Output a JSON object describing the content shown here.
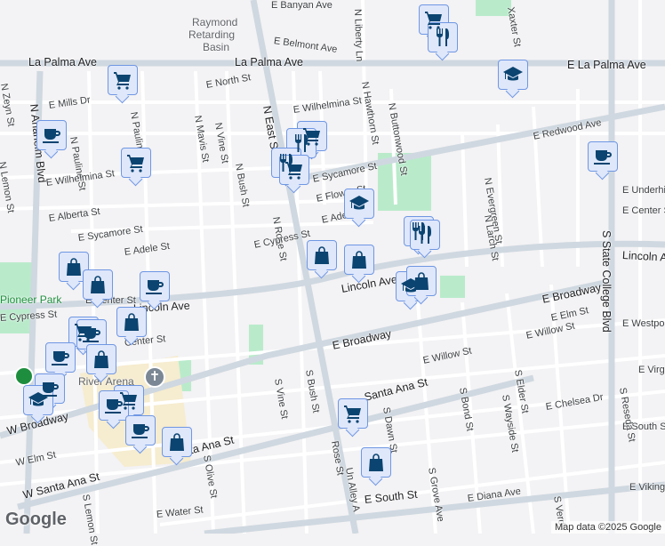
{
  "streets": [
    "E Banyan Ave",
    "Raymond",
    "Retarding",
    "Basin",
    "E Belmont Ave",
    "La Palma Ave",
    "La Palma Ave",
    "E La Palma Ave",
    "E North St",
    "N East St",
    "E Wilhelmina St",
    "E Mills Dr",
    "N Pauline St",
    "N Mavis St",
    "N Vine St",
    "N Bush St",
    "N Rose St",
    "E Sycamore St",
    "E Redwood Ave",
    "E Flower St",
    "E Adele St",
    "E Cypress St",
    "Lincoln Ave",
    "Lincoln Ave",
    "E Broadway",
    "E Broadway",
    "E Elm St",
    "E Willow St",
    "E Willow St",
    "S State College Blvd",
    "E Underhill",
    "E Center St",
    "E Westport",
    "E Virg",
    "E Chelsea Dr",
    "E South St",
    "E South St",
    "E Diana Ave",
    "E Viking A",
    "W Broadway",
    "W Elm St",
    "W Santa Ana St",
    "Santa Ana St",
    "Santa Ana St",
    "E Water St",
    "S Lemon St",
    "S Olive St",
    "S Vine St",
    "S Bush St",
    "S Dawn St",
    "S Grove Ave",
    "S Bond St",
    "S Wayside St",
    "S Elder St",
    "N Evergreen St",
    "N Larch St",
    "N Buttonwood St",
    "N Hawthorn St",
    "N Liberty Ln",
    "N Zeyn St",
    "N Lemon St",
    "N Anaheim Blvd",
    "N Pauline St",
    "E Wilhelmina St",
    "E Alberta St",
    "E Sycamore St",
    "E Adele St",
    "Lincoln Ave",
    "Center St",
    "S Reseda St",
    "S Verde",
    "Un Alley A",
    "Rose St",
    "Pioneer Park",
    "River Arena",
    "E Cypress St",
    "E Center St",
    "Xaxter St"
  ],
  "markers": [
    {
      "type": "shopping-cart"
    },
    {
      "type": "restaurant"
    },
    {
      "type": "shopping-cart"
    },
    {
      "type": "coffee"
    },
    {
      "type": "school"
    },
    {
      "type": "shopping-cart"
    },
    {
      "type": "coffee"
    },
    {
      "type": "shopping-cart"
    },
    {
      "type": "restaurant"
    },
    {
      "type": "restaurant"
    },
    {
      "type": "shopping-cart"
    },
    {
      "type": "school"
    },
    {
      "type": "restaurant"
    },
    {
      "type": "restaurant"
    },
    {
      "type": "shopping-bag"
    },
    {
      "type": "shopping-bag"
    },
    {
      "type": "shopping-bag"
    },
    {
      "type": "shopping-bag"
    },
    {
      "type": "coffee"
    },
    {
      "type": "school"
    },
    {
      "type": "shopping-bag"
    },
    {
      "type": "shopping-cart"
    },
    {
      "type": "coffee"
    },
    {
      "type": "coffee"
    },
    {
      "type": "shopping-bag"
    },
    {
      "type": "coffee"
    },
    {
      "type": "shopping-bag"
    },
    {
      "type": "school"
    },
    {
      "type": "shopping-cart"
    },
    {
      "type": "coffee"
    },
    {
      "type": "coffee"
    },
    {
      "type": "shopping-bag"
    },
    {
      "type": "shopping-cart"
    },
    {
      "type": "shopping-bag"
    }
  ],
  "attribution": {
    "logo": "Google",
    "text": "Map data ©2025 Google"
  },
  "colors": {
    "marker_bg": "#dfe7fb",
    "marker_border": "#6f97e3",
    "icon": "#0b4470",
    "park": "#a8e6c1",
    "road": "#ffffff",
    "major_road": "#cfd8e0"
  }
}
